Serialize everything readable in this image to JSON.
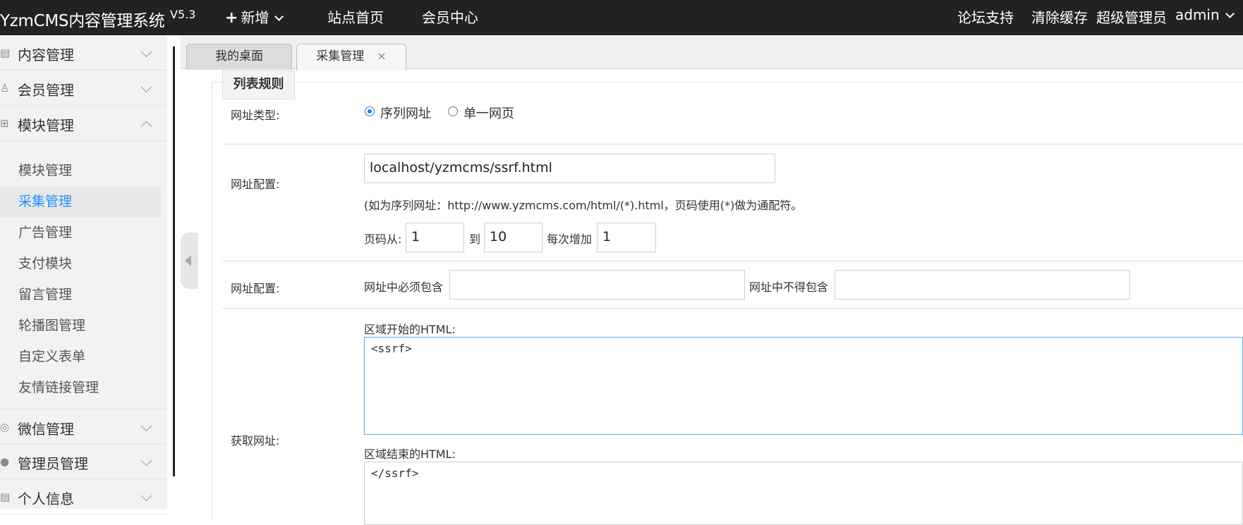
{
  "header": {
    "brand": "YzmCMS内容管理系统",
    "version": "V5.3",
    "add_label": "新增",
    "nav": [
      "站点首页",
      "会员中心"
    ],
    "right": [
      "论坛支持",
      "清除缓存",
      "超级管理员"
    ],
    "user": "admin"
  },
  "sidebar": {
    "groups": [
      {
        "label": "内容管理",
        "icon": "document-icon",
        "expanded": false
      },
      {
        "label": "会员管理",
        "icon": "user-icon",
        "expanded": false
      },
      {
        "label": "模块管理",
        "icon": "grid-icon",
        "expanded": true
      },
      {
        "label": "微信管理",
        "icon": "wechat-icon",
        "expanded": false
      },
      {
        "label": "管理员管理",
        "icon": "admin-icon",
        "expanded": false
      },
      {
        "label": "个人信息",
        "icon": "profile-icon",
        "expanded": false
      }
    ],
    "sub_items": [
      "模块管理",
      "采集管理",
      "广告管理",
      "支付模块",
      "留言管理",
      "轮播图管理",
      "自定义表单",
      "友情链接管理"
    ],
    "active_sub": "采集管理"
  },
  "tabs": [
    {
      "label": "我的桌面"
    },
    {
      "label": "采集管理",
      "close": "×"
    }
  ],
  "form": {
    "legend": "列表规则",
    "url_type": {
      "label": "网址类型:",
      "options": [
        "序列网址",
        "单一网页"
      ],
      "selected": "序列网址"
    },
    "url_config": {
      "label": "网址配置:",
      "url_value": "localhost/yzmcms/ssrf.html",
      "hint": "(如为序列网址：http://www.yzmcms.com/html/(*).html，页码使用(*)做为通配符。",
      "page_from_label": "页码从:",
      "page_from": "1",
      "to_label": "到",
      "page_to": "10",
      "step_label": "每次增加",
      "step": "1"
    },
    "url_filter": {
      "label": "网址配置:",
      "must_contain_label": "网址中必须包含",
      "must_contain": "",
      "not_contain_label": "网址中不得包含",
      "not_contain": ""
    },
    "fetch": {
      "label": "获取网址:",
      "start_label": "区域开始的HTML:",
      "start_html": "<ssrf>",
      "end_label": "区域结束的HTML:",
      "end_html": "</ssrf>"
    }
  }
}
